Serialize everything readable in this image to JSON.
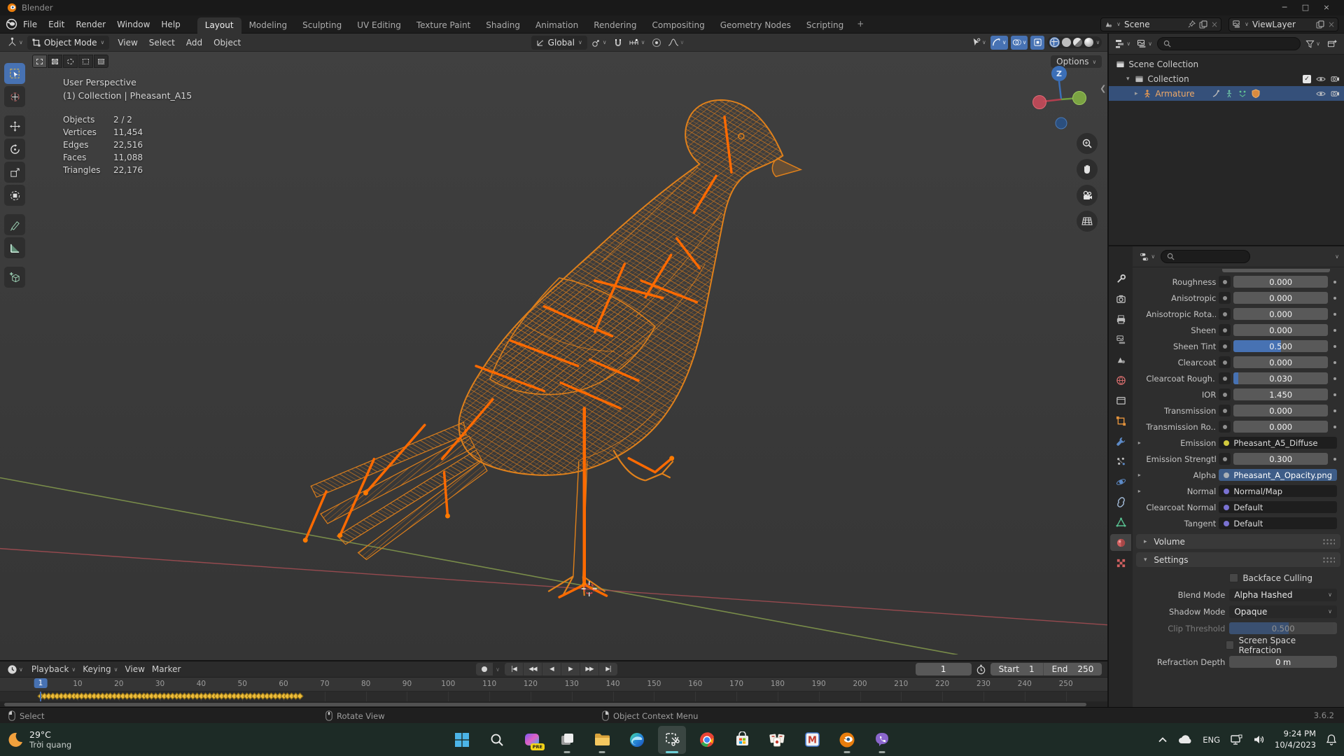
{
  "window": {
    "title": "Blender",
    "minimize": "─",
    "maximize": "□",
    "close": "×"
  },
  "topbar": {
    "menus": [
      "File",
      "Edit",
      "Render",
      "Window",
      "Help"
    ],
    "workspaces": [
      {
        "label": "Layout",
        "active": true
      },
      {
        "label": "Modeling"
      },
      {
        "label": "Sculpting"
      },
      {
        "label": "UV Editing"
      },
      {
        "label": "Texture Paint"
      },
      {
        "label": "Shading"
      },
      {
        "label": "Animation"
      },
      {
        "label": "Rendering"
      },
      {
        "label": "Compositing"
      },
      {
        "label": "Geometry Nodes"
      },
      {
        "label": "Scripting"
      }
    ],
    "add_tab": "+",
    "scene_name": "Scene",
    "view_layer_name": "ViewLayer"
  },
  "viewport": {
    "mode": "Object Mode",
    "menus": [
      "View",
      "Select",
      "Add",
      "Object"
    ],
    "orientation": "Global",
    "options_label": "Options",
    "gizmo_z": "Z",
    "overlay": {
      "title": "User Perspective",
      "subtitle": "(1) Collection | Pheasant_A15",
      "stats": [
        {
          "label": "Objects",
          "value": "2 / 2"
        },
        {
          "label": "Vertices",
          "value": "11,454"
        },
        {
          "label": "Edges",
          "value": "22,516"
        },
        {
          "label": "Faces",
          "value": "11,088"
        },
        {
          "label": "Triangles",
          "value": "22,176"
        }
      ]
    }
  },
  "outliner": {
    "rows": [
      {
        "label": "Scene Collection"
      },
      {
        "label": "Collection"
      },
      {
        "label": "Armature"
      }
    ]
  },
  "properties": {
    "rows": [
      {
        "label": "Roughness",
        "type": "slider",
        "value": "0.000",
        "fill": 0
      },
      {
        "label": "Anisotropic",
        "type": "slider",
        "value": "0.000",
        "fill": 0
      },
      {
        "label": "Anisotropic Rota...",
        "type": "slider",
        "value": "0.000",
        "fill": 0
      },
      {
        "label": "Sheen",
        "type": "slider",
        "value": "0.000",
        "fill": 0
      },
      {
        "label": "Sheen Tint",
        "type": "slider",
        "value": "0.500",
        "fill": 50
      },
      {
        "label": "Clearcoat",
        "type": "slider",
        "value": "0.000",
        "fill": 0
      },
      {
        "label": "Clearcoat Rough...",
        "type": "slider",
        "value": "0.030",
        "fill": 5
      },
      {
        "label": "IOR",
        "type": "slider",
        "value": "1.450",
        "fill": 0
      },
      {
        "label": "Transmission",
        "type": "slider",
        "value": "0.000",
        "fill": 0
      },
      {
        "label": "Transmission Ro...",
        "type": "slider",
        "value": "0.000",
        "fill": 0
      },
      {
        "label": "Emission",
        "type": "texture",
        "value": "Pheasant_A5_Diffuse",
        "dot": "#d2ca3e",
        "expand": true
      },
      {
        "label": "Emission Strength",
        "type": "slider",
        "value": "0.300",
        "fill": 0
      },
      {
        "label": "Alpha",
        "type": "texture",
        "value": "Pheasant_A_Opacity.png",
        "dot": "#a9b0b6",
        "expand": true,
        "highlight": true
      },
      {
        "label": "Normal",
        "type": "texture",
        "value": "Normal/Map",
        "dot": "#7a72d2",
        "expand": true
      },
      {
        "label": "Clearcoat Normal",
        "type": "texture",
        "value": "Default",
        "dot": "#7a72d2"
      },
      {
        "label": "Tangent",
        "type": "texture",
        "value": "Default",
        "dot": "#7a72d2"
      }
    ],
    "sections": [
      {
        "label": "Volume"
      },
      {
        "label": "Settings"
      }
    ],
    "settings": {
      "backface_label": "Backface Culling",
      "blend_label": "Blend Mode",
      "blend_value": "Alpha Hashed",
      "shadow_label": "Shadow Mode",
      "shadow_value": "Opaque",
      "clip_label": "Clip Threshold",
      "clip_value": "0.500",
      "ssr_label": "Screen Space Refraction",
      "refraction_label": "Refraction Depth",
      "refraction_value": "0 m"
    }
  },
  "timeline": {
    "menus": [
      {
        "label": "Playback",
        "caret": true
      },
      {
        "label": "Keying",
        "caret": true
      },
      {
        "label": "View"
      },
      {
        "label": "Marker"
      }
    ],
    "current_frame": 1,
    "start_label": "Start",
    "start_value": "1",
    "end_label": "End",
    "end_value": "250",
    "ticks": [
      1,
      10,
      20,
      30,
      40,
      50,
      60,
      70,
      80,
      90,
      100,
      110,
      120,
      130,
      140,
      150,
      160,
      170,
      180,
      190,
      200,
      210,
      220,
      230,
      240,
      250
    ],
    "keyframes": {
      "from": 1,
      "to": 64
    }
  },
  "statusbar": {
    "items": [
      {
        "label": "Select"
      },
      {
        "label": "Rotate View"
      },
      {
        "label": "Object Context Menu"
      }
    ],
    "version": "3.6.2"
  },
  "taskbar": {
    "weather": {
      "temp": "29°C",
      "condition": "Trời quang"
    },
    "copilot_badge": "PRE",
    "tray": {
      "lang": "ENG",
      "time": "9:24 PM",
      "date": "10/4/2023"
    }
  }
}
